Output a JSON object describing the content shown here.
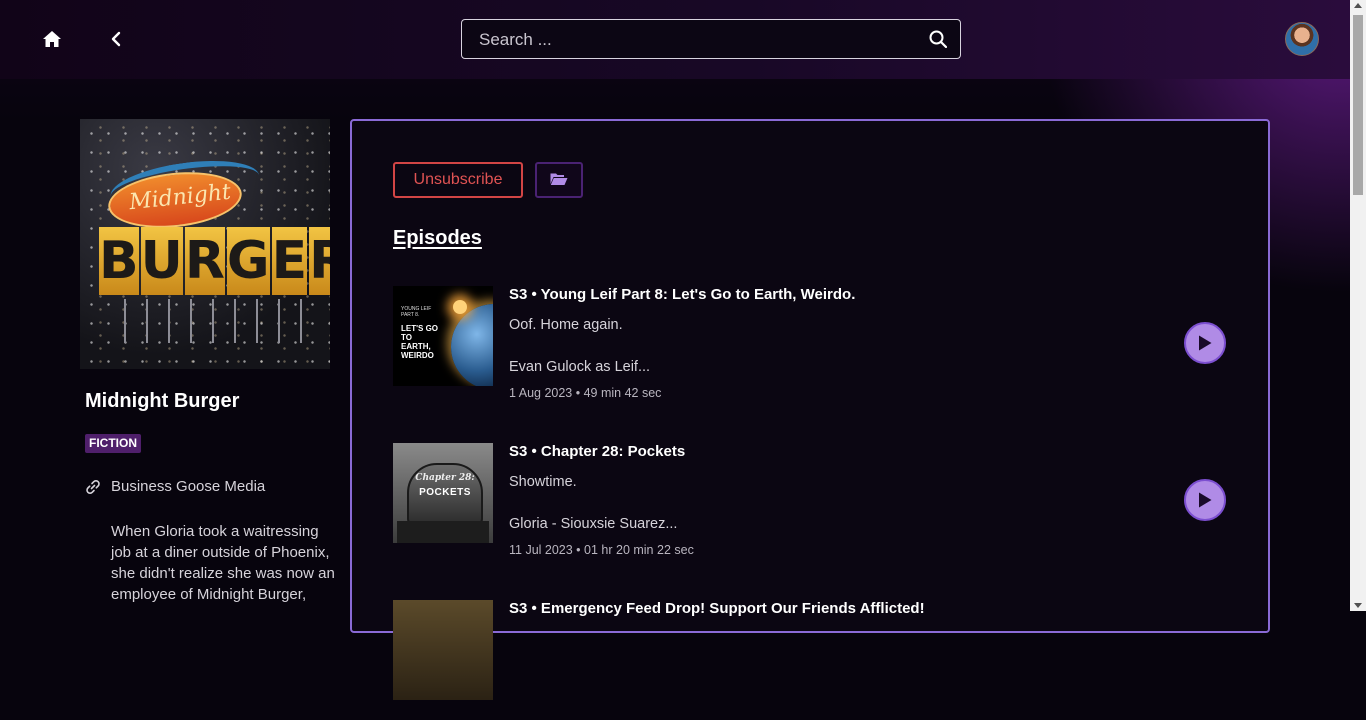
{
  "header": {
    "search_placeholder": "Search ..."
  },
  "podcast": {
    "title": "Midnight Burger",
    "genre": "FICTION",
    "publisher": "Business Goose Media",
    "description": "When Gloria took a waitressing job at a diner outside of Phoenix, she didn't realize she was now an employee of Midnight Burger,",
    "cover": {
      "top_text": "Midnight",
      "main_text": "BURGER"
    }
  },
  "actions": {
    "unsubscribe_label": "Unsubscribe",
    "folder_icon": "folder-open-icon"
  },
  "episodes_heading": "Episodes",
  "episodes": [
    {
      "title": "S3 • Young Leif Part 8: Let's Go to Earth, Weirdo.",
      "subtitle": "Oof. Home again.",
      "description": "Evan Gulock as Leif...",
      "meta": "1 Aug 2023 • 49 min 42 sec",
      "thumb_small": "YOUNG LEIF PART 8.",
      "thumb_big": "LET'S GO TO EARTH, WEIRDO"
    },
    {
      "title": "S3 • Chapter 28: Pockets",
      "subtitle": "Showtime.",
      "description": "Gloria - Siouxsie Suarez...",
      "meta": "11 Jul 2023 • 01 hr 20 min 22 sec",
      "thumb_small": "Chapter 28:",
      "thumb_big": "POCKETS"
    },
    {
      "title": "S3 • Emergency Feed Drop! Support Our Friends Afflicted!"
    }
  ],
  "colors": {
    "accent": "#8a6ad6",
    "play": "#b08be6",
    "danger": "#d24545",
    "badge": "#4f1f6b"
  }
}
